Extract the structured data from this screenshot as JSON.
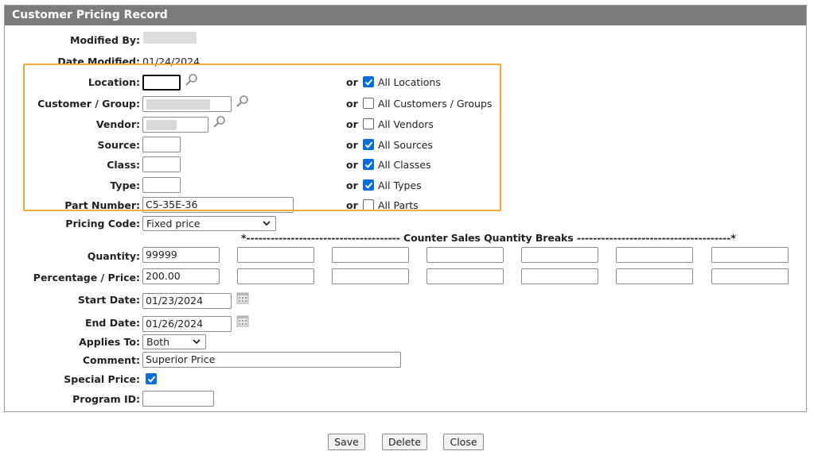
{
  "title": "Customer Pricing Record",
  "fields": {
    "modified_by_label": "Modified By:",
    "date_modified_label": "Date Modified:",
    "date_modified_value": "01/24/2024",
    "location_label": "Location:",
    "customer_label": "Customer / Group:",
    "vendor_label": "Vendor:",
    "source_label": "Source:",
    "class_label": "Class:",
    "type_label": "Type:",
    "part_label": "Part Number:",
    "part_value": "C5-35E-36",
    "pricing_code_label": "Pricing Code:",
    "pricing_code_value": "Fixed price",
    "breaks_header": "*-------------------------------------- Counter Sales Quantity Breaks --------------------------------------*",
    "quantity_label": "Quantity:",
    "quantity_value": "99999",
    "pct_label": "Percentage / Price:",
    "pct_value": "200.00",
    "start_label": "Start Date:",
    "start_value": "01/23/2024",
    "end_label": "End Date:",
    "end_value": "01/26/2024",
    "applies_label": "Applies To:",
    "applies_value": "Both",
    "comment_label": "Comment:",
    "comment_value": "Superior Price",
    "special_label": "Special Price:",
    "special_checked": true,
    "program_label": "Program ID:"
  },
  "or_text": "or",
  "all_options": [
    {
      "label": "All Locations",
      "checked": true
    },
    {
      "label": "All Customers / Groups",
      "checked": false
    },
    {
      "label": "All Vendors",
      "checked": false
    },
    {
      "label": "All Sources",
      "checked": true
    },
    {
      "label": "All Classes",
      "checked": true
    },
    {
      "label": "All Types",
      "checked": true
    },
    {
      "label": "All Parts",
      "checked": false
    }
  ],
  "buttons": {
    "save": "Save",
    "delete": "Delete",
    "close": "Close"
  },
  "colors": {
    "title_bar": "#7b7b7b",
    "highlight": "#f2a83a",
    "checkbox": "#0b6ed8"
  }
}
